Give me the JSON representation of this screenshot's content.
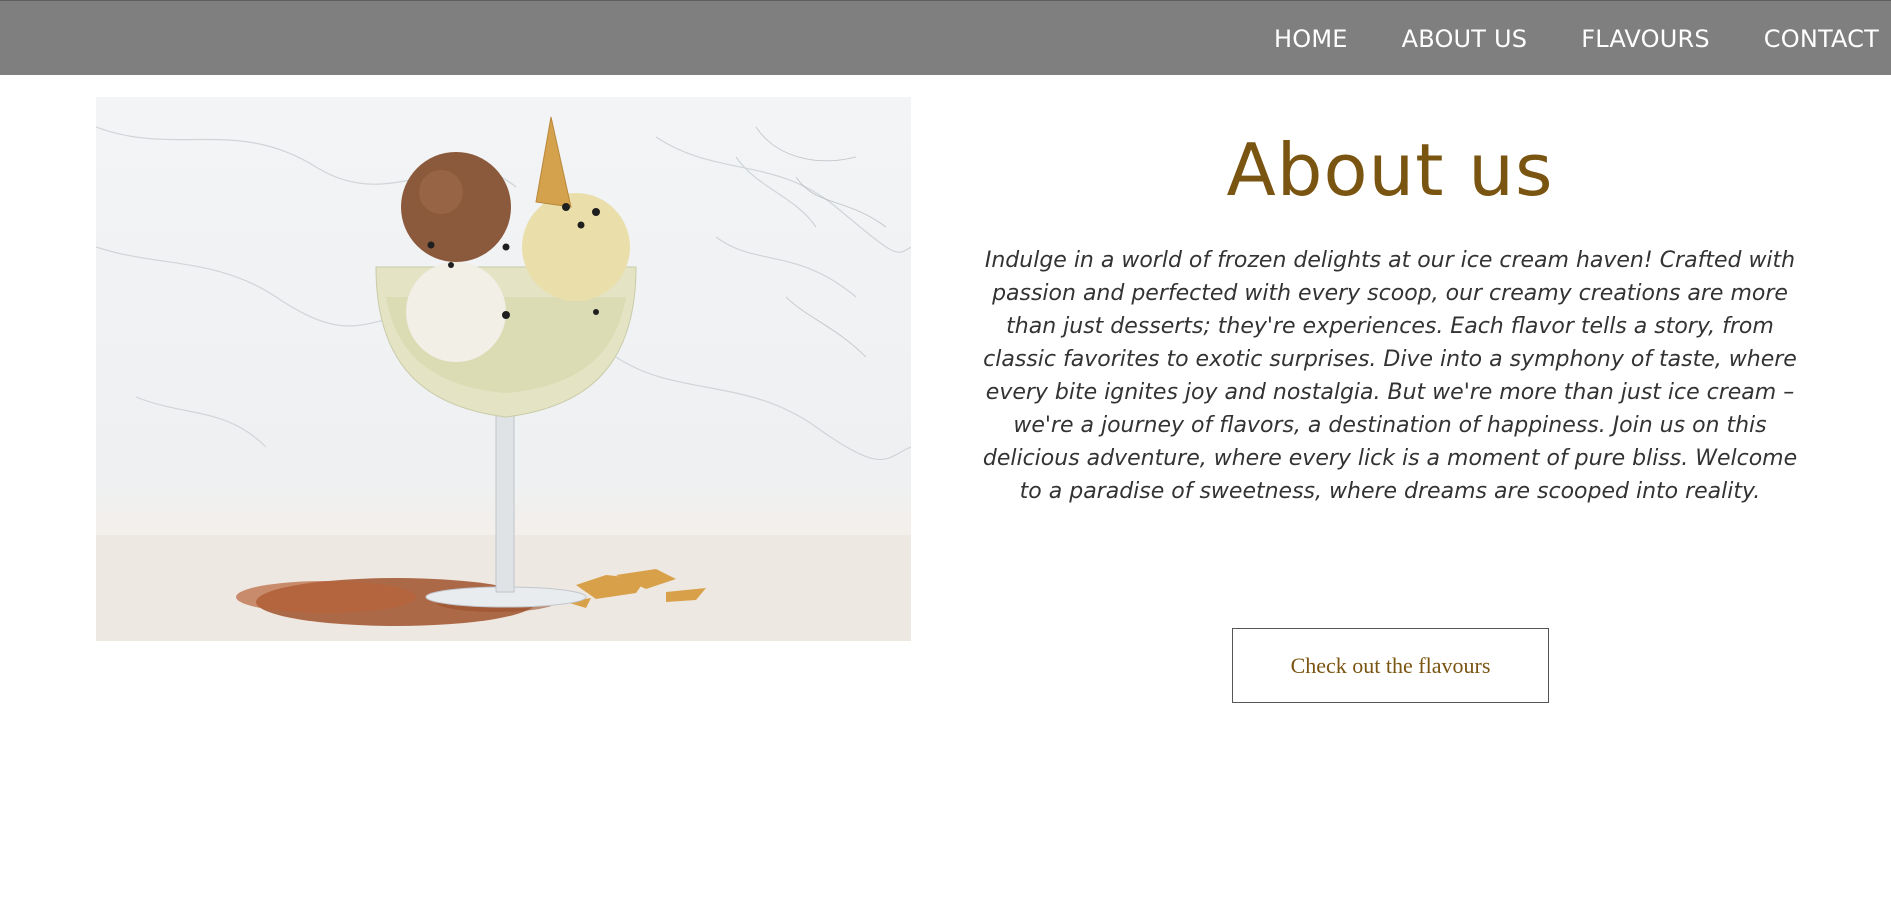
{
  "nav": {
    "items": [
      {
        "label": "HOME"
      },
      {
        "label": "ABOUT US"
      },
      {
        "label": "FLAVOURS"
      },
      {
        "label": "CONTACT"
      }
    ]
  },
  "hero": {
    "image_description_icon": "ice-cream-sundae-image"
  },
  "about": {
    "title": "About us",
    "paragraph": "Indulge in a world of frozen delights at our ice cream haven! Crafted with passion and perfected with every scoop, our creamy creations are more than just desserts; they're experiences. Each flavor tells a story, from classic favorites to exotic surprises. Dive into a symphony of taste, where every bite ignites joy and nostalgia. But we're more than just ice cream – we're a journey of flavors, a destination of happiness. Join us on this delicious adventure, where every lick is a moment of pure bliss. Welcome to a paradise of sweetness, where dreams are scooped into reality."
  },
  "cta": {
    "label": "Check out the flavours"
  },
  "colors": {
    "navbar": "#7f7f7f",
    "accent": "#7a5411",
    "text": "#333333"
  }
}
